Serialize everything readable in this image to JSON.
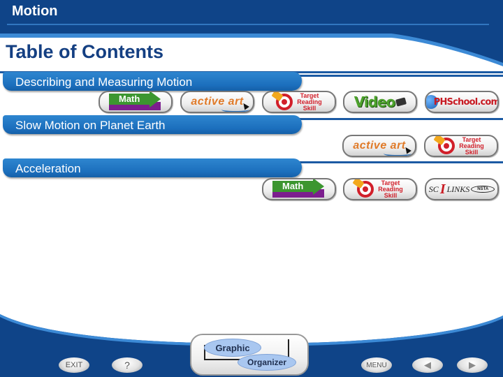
{
  "header": {
    "app_title": "Motion",
    "page_title": "Table of Contents"
  },
  "colors": {
    "header_blue": "#0f4488",
    "section_blue": "#1c6fbd",
    "title_blue": "#143f82",
    "accent_red": "#d11f2a"
  },
  "sections": [
    {
      "label": "Describing and Measuring Motion",
      "resources": [
        "Math",
        "active art",
        "Target Reading Skill",
        "Video",
        "PHSchool.com"
      ]
    },
    {
      "label": "Slow Motion on Planet Earth",
      "resources": [
        "active art",
        "Target Reading Skill"
      ]
    },
    {
      "label": "Acceleration",
      "resources": [
        "Math",
        "Target Reading Skill",
        "SciLinks"
      ]
    }
  ],
  "resource_labels": {
    "math": "Math",
    "active_art": "active art",
    "trs_line1": "Target",
    "trs_line2": "Reading",
    "trs_line3": "Skill",
    "video": "Video",
    "phschool": "PHSchool.com",
    "scilinks_sc": "SC",
    "scilinks_i": "I",
    "scilinks_links": "LINKS",
    "scilinks_nsta": "NSTA"
  },
  "footer": {
    "exit_label": "EXIT",
    "help_label": "?",
    "graphic_organizer_line1": "Graphic",
    "graphic_organizer_line2": "Organizer",
    "menu_label": "MENU",
    "prev_icon": "◀",
    "next_icon": "▶"
  }
}
